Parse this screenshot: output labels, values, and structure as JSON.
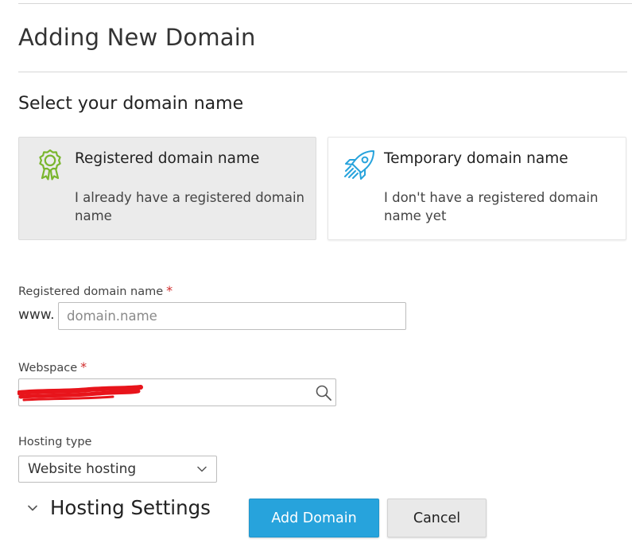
{
  "page": {
    "title": "Adding New Domain",
    "section_title": "Select your domain name"
  },
  "domain_options": [
    {
      "heading": "Registered domain name",
      "description": "I already have a registered domain name",
      "icon": "award-ribbon-icon",
      "icon_color": "#7ab62e",
      "selected": true
    },
    {
      "heading": "Temporary domain name",
      "description": "I don't have a registered domain name yet",
      "icon": "rocket-icon",
      "icon_color": "#27a3dc",
      "selected": false
    }
  ],
  "form": {
    "domain_field": {
      "label": "Registered domain name",
      "required_mark": "*",
      "prefix": "www.",
      "value": "",
      "placeholder": "domain.name"
    },
    "webspace_field": {
      "label": "Webspace",
      "required_mark": "*",
      "value": ""
    },
    "hosting_type": {
      "label": "Hosting type",
      "selected": "Website hosting"
    }
  },
  "hosting_settings": {
    "label": "Hosting Settings"
  },
  "actions": {
    "add_label": "Add Domain",
    "cancel_label": "Cancel"
  },
  "colors": {
    "primary_button": "#27a3dc",
    "required_mark": "#d02b2b",
    "redaction": "#e8141b"
  }
}
